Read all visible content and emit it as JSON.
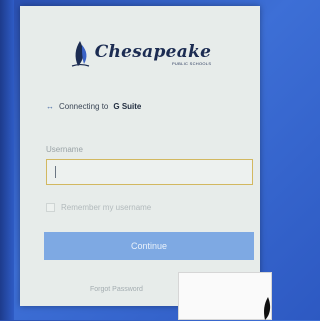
{
  "logo": {
    "name": "Chesapeake",
    "sub": "PUBLIC SCHOOLS"
  },
  "connecting": {
    "prefix": "Connecting to",
    "target": "G Suite",
    "icon": "arrows-icon"
  },
  "form": {
    "username_label": "Username",
    "username_value": "",
    "remember_label": "Remember my username",
    "continue_label": "Continue",
    "forgot_label": "Forgot Password"
  },
  "colors": {
    "accent": "#7ea9e3",
    "background": "#2f5cc6",
    "input_border": "#d2b860"
  }
}
